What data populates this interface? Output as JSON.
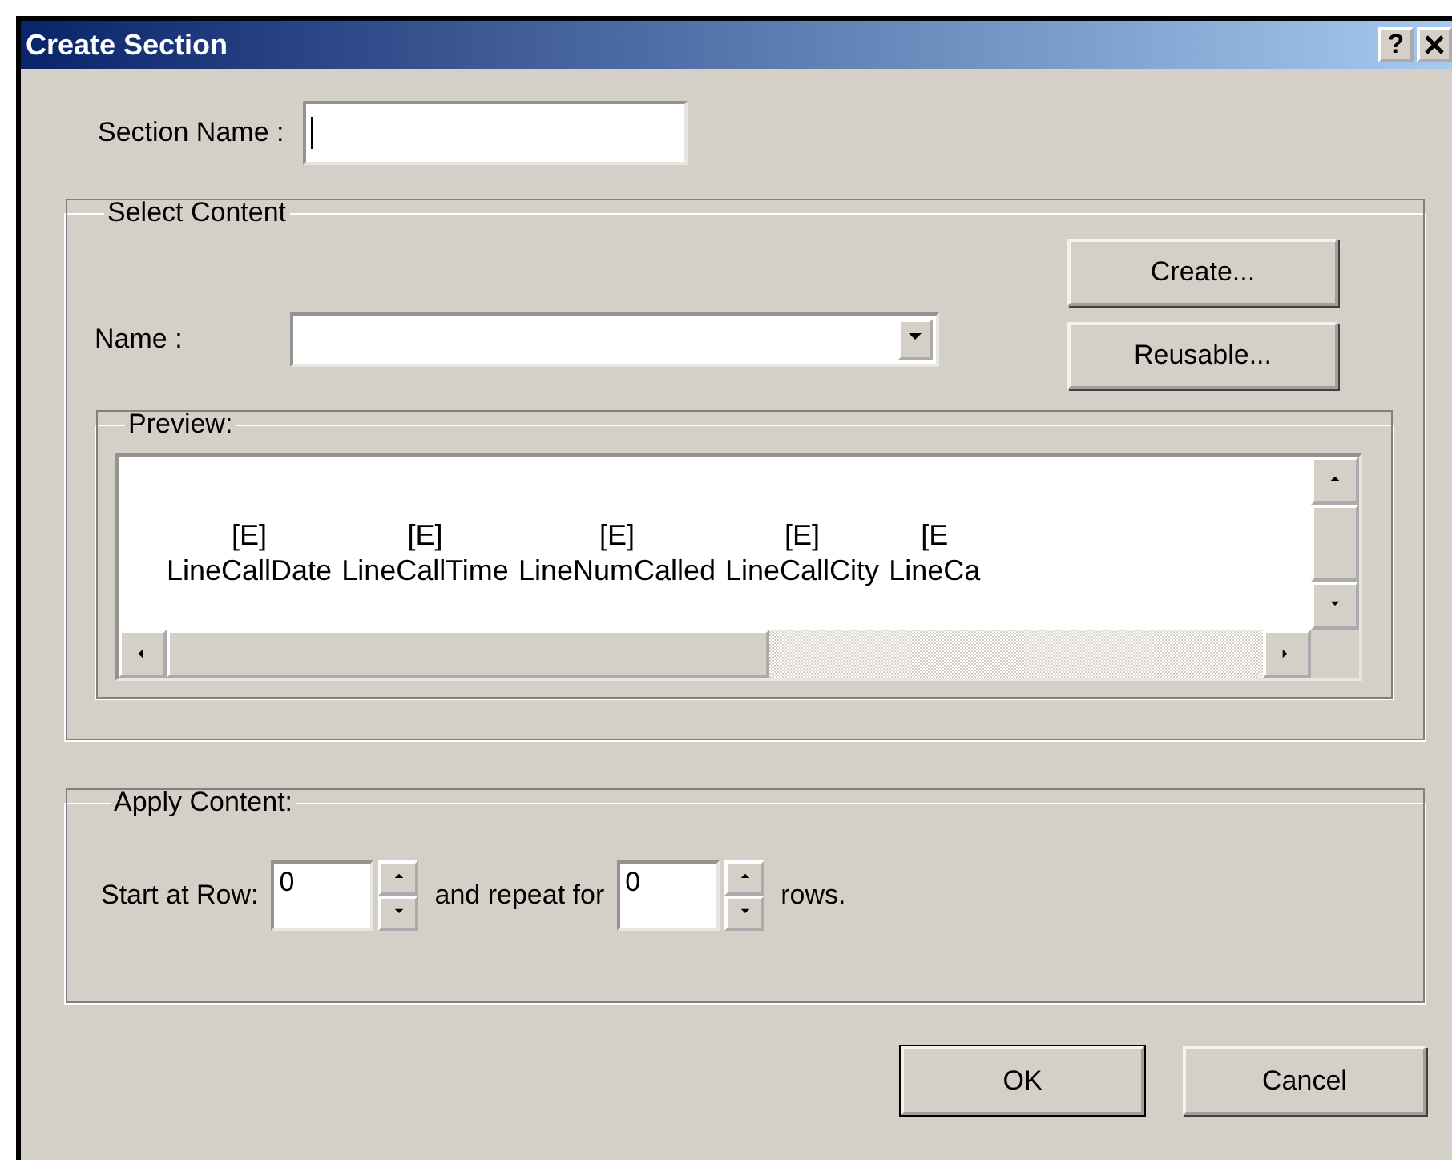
{
  "window": {
    "title": "Create Section",
    "help": "?"
  },
  "section_name": {
    "label": "Section Name :",
    "focused": true
  },
  "select_content": {
    "title": "Select Content",
    "name_label": "Name :",
    "buttons": [
      "Create...",
      "Reusable..."
    ],
    "preview": {
      "title": "Preview:",
      "columns": [
        {
          "tag": "[E]",
          "name": "LineCallDate"
        },
        {
          "tag": "[E]",
          "name": "LineCallTime"
        },
        {
          "tag": "[E]",
          "name": "LineNumCalled"
        },
        {
          "tag": "[E]",
          "name": "LineCallCity"
        },
        {
          "tag": "[E",
          "name": "LineCa"
        }
      ]
    }
  },
  "apply_content": {
    "title": "Apply Content:",
    "start_label": "Start at Row:",
    "start_value": "0",
    "repeat_label": "and repeat for",
    "repeat_value": "0",
    "rows_label": "rows."
  },
  "buttons": [
    {
      "label": "OK",
      "default": true
    },
    {
      "label": "Cancel",
      "default": false
    }
  ]
}
